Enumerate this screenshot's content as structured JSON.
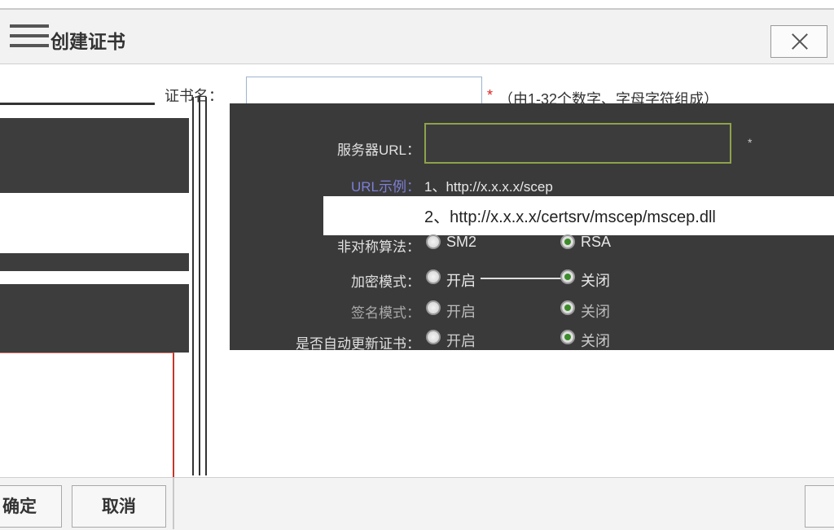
{
  "dialog": {
    "title": "创建证书",
    "close_label": "close"
  },
  "form": {
    "cert_name_label": "证书名：",
    "cert_name_value": "",
    "required_mark": "*",
    "cert_name_hint": "（由1-32个数字、字母字符组成）",
    "url_label": "服务器URL：",
    "url_value": "",
    "url_required": "*",
    "url_example_label": "URL示例：",
    "url_example_1": "1、http://x.x.x.x/scep",
    "url_example_2": "2、http://x.x.x.x/certsrv/mscep/mscep.dll",
    "algorithm_label": "非对称算法：",
    "algorithm_options": [
      "SM2",
      "RSA"
    ],
    "algorithm_selected": "RSA",
    "row2_label": "加密模式：",
    "row2_options": [
      "开启",
      "关闭"
    ],
    "row2_selected": "关闭",
    "row3_label": "签名模式：",
    "row3_options": [
      "开启",
      "关闭"
    ],
    "row3_selected": "关闭",
    "row4_label": "是否自动更新证书：",
    "row4_options": [
      "开启",
      "关闭"
    ],
    "row4_selected": "关闭"
  },
  "footer": {
    "left_confirm": "确定",
    "left_cancel": "取消"
  }
}
